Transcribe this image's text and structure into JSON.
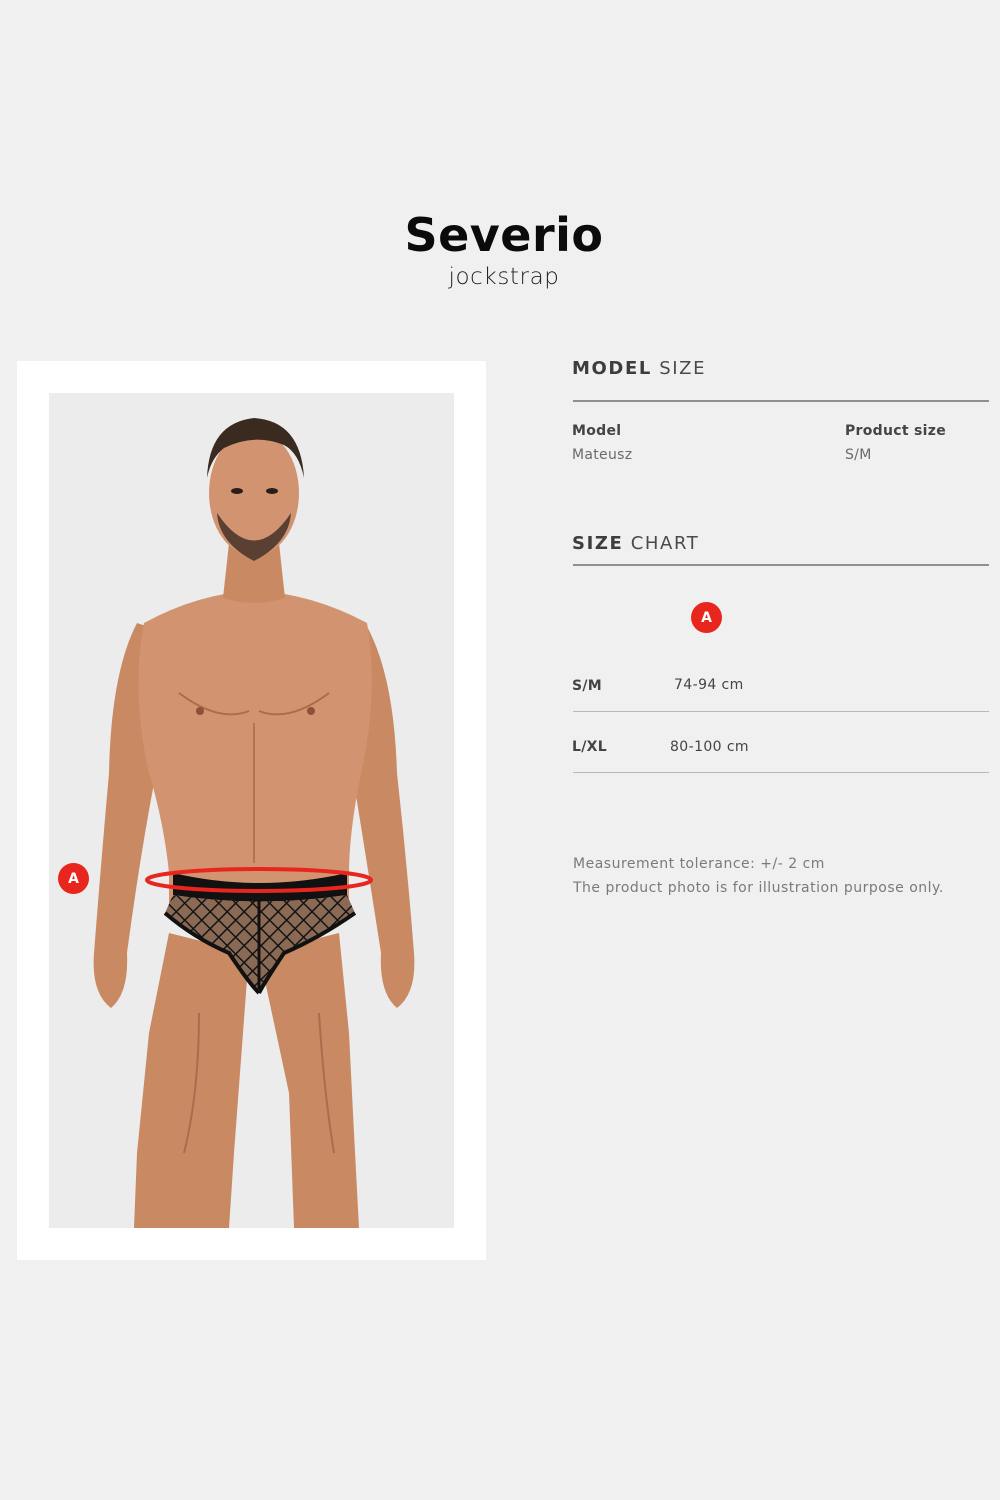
{
  "product": {
    "name": "Severio",
    "type": "jockstrap"
  },
  "model_size": {
    "heading_bold": "MODEL",
    "heading_light": "SIZE",
    "model_label": "Model",
    "model_value": "Mateusz",
    "product_size_label": "Product size",
    "product_size_value": "S/M"
  },
  "size_chart": {
    "heading_bold": "SIZE",
    "heading_light": "CHART",
    "column_marker": "A",
    "rows": [
      {
        "size": "S/M",
        "measure": "74-94 cm"
      },
      {
        "size": "L/XL",
        "measure": "80-100 cm"
      }
    ]
  },
  "photo": {
    "marker": "A",
    "marker_color": "#e8261d"
  },
  "notes": {
    "tolerance": "Measurement tolerance: +/- 2 cm",
    "disclaimer": "The product photo is for illustration purpose only."
  },
  "colors": {
    "background": "#f0f0f0",
    "accent": "#e8261d"
  }
}
